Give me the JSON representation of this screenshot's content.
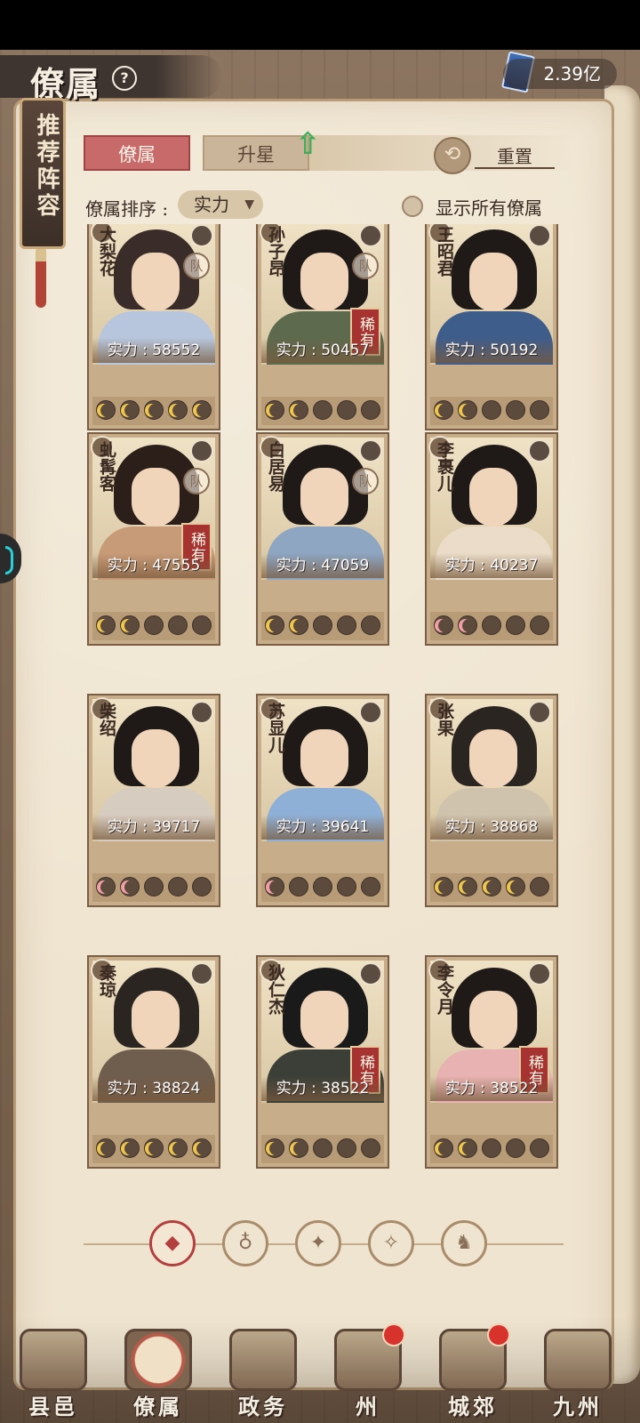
{
  "header": {
    "title": "僚属",
    "help": "?",
    "currency_value": "2.39亿",
    "recommend_label": "推荐阵容"
  },
  "tabs": [
    {
      "label": "僚属",
      "active": true
    },
    {
      "label": "升星",
      "active": false
    }
  ],
  "reset_label": "重置",
  "sort": {
    "label": "僚属排序 :",
    "selected": "实力"
  },
  "show_all_label": "显示所有僚属",
  "cards": [
    {
      "name": "大梨花",
      "power": "实力 : 58552",
      "stars_filled": 5,
      "star_color": "gold",
      "rare": false,
      "team": true,
      "robe": "#b7c6dc",
      "hair": "#3a2c28"
    },
    {
      "name": "孙子昂",
      "power": "实力 : 50457",
      "stars_filled": 2,
      "star_color": "gold",
      "rare": true,
      "team": true,
      "robe": "#5e6a4e",
      "hair": "#1f1a18"
    },
    {
      "name": "王昭君",
      "power": "实力 : 50192",
      "stars_filled": 2,
      "star_color": "gold",
      "rare": false,
      "team": false,
      "robe": "#3f5d8a",
      "hair": "#1f1a18"
    },
    {
      "name": "虬髯客",
      "power": "实力 : 47555",
      "stars_filled": 2,
      "star_color": "gold",
      "rare": true,
      "team": true,
      "robe": "#c89b78",
      "hair": "#2c1f1a"
    },
    {
      "name": "白居易",
      "power": "实力 : 47059",
      "stars_filled": 2,
      "star_color": "gold",
      "rare": false,
      "team": true,
      "robe": "#8ea6c2",
      "hair": "#1f1a18"
    },
    {
      "name": "李裹儿",
      "power": "实力 : 40237",
      "stars_filled": 2,
      "star_color": "pink",
      "rare": false,
      "team": false,
      "robe": "#eadcc8",
      "hair": "#1f1a18"
    },
    {
      "name": "柴绍",
      "power": "实力 : 39717",
      "stars_filled": 2,
      "star_color": "pink",
      "rare": false,
      "team": false,
      "robe": "#d7ccc0",
      "hair": "#1f1a18"
    },
    {
      "name": "苏显儿",
      "power": "实力 : 39641",
      "stars_filled": 1,
      "star_color": "pink",
      "rare": false,
      "team": false,
      "robe": "#8fb0d6",
      "hair": "#1f1a18"
    },
    {
      "name": "张果",
      "power": "实力 : 38868",
      "stars_filled": 4,
      "star_color": "gold",
      "rare": false,
      "team": false,
      "robe": "#cfc3ad",
      "hair": "#2b2522"
    },
    {
      "name": "秦琼",
      "power": "实力 : 38824",
      "stars_filled": 5,
      "star_color": "gold",
      "rare": false,
      "team": false,
      "robe": "#6f5d4e",
      "hair": "#2b2522"
    },
    {
      "name": "狄仁杰",
      "power": "实力 : 38522",
      "stars_filled": 2,
      "star_color": "gold",
      "rare": true,
      "team": false,
      "robe": "#3c3f38",
      "hair": "#1a1a1a"
    },
    {
      "name": "李令月",
      "power": "实力 : 38522",
      "stars_filled": 2,
      "star_color": "gold",
      "rare": true,
      "team": false,
      "robe": "#e7b2b1",
      "hair": "#1f1a18"
    }
  ],
  "rare_label": "稀有",
  "team_label": "队",
  "filters": [
    "all-filter",
    "bell-filter",
    "tiger-filter",
    "fan-filter",
    "dragon-filter"
  ],
  "nav": [
    {
      "label": "县邑",
      "dot": false,
      "active": false
    },
    {
      "label": "僚属",
      "dot": false,
      "active": true
    },
    {
      "label": "政务",
      "dot": false,
      "active": false
    },
    {
      "label": "州",
      "dot": true,
      "active": false
    },
    {
      "label": "城郊",
      "dot": true,
      "active": false
    },
    {
      "label": "九州",
      "dot": false,
      "active": false
    }
  ],
  "colors": {
    "accent_red": "#b33f3f",
    "paper": "#efe4cf",
    "gold_star": "#f0c74d",
    "pink_star": "#f2a0a7"
  }
}
